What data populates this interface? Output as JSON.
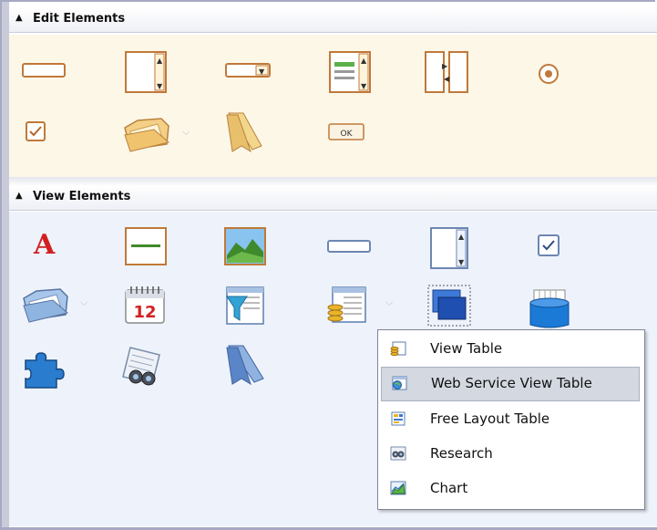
{
  "edit_section": {
    "title": "Edit Elements"
  },
  "view_section": {
    "title": "View Elements"
  },
  "edit_icons": {
    "button_label": "OK"
  },
  "view_icons": {
    "text_glyph": "A",
    "calendar_day": "12"
  },
  "menu": {
    "items": [
      {
        "label": "View Table",
        "icon": "view-table-icon"
      },
      {
        "label": "Web Service View Table",
        "icon": "web-service-table-icon",
        "selected": true
      },
      {
        "label": "Free Layout Table",
        "icon": "free-layout-table-icon"
      },
      {
        "label": "Research",
        "icon": "research-icon"
      },
      {
        "label": "Chart",
        "icon": "chart-icon"
      }
    ]
  },
  "colors": {
    "edit_background": "#fdf7e8",
    "view_background": "#eef3fb",
    "selected_item": "#d3d8e1",
    "frame": "#a7a9c4"
  }
}
